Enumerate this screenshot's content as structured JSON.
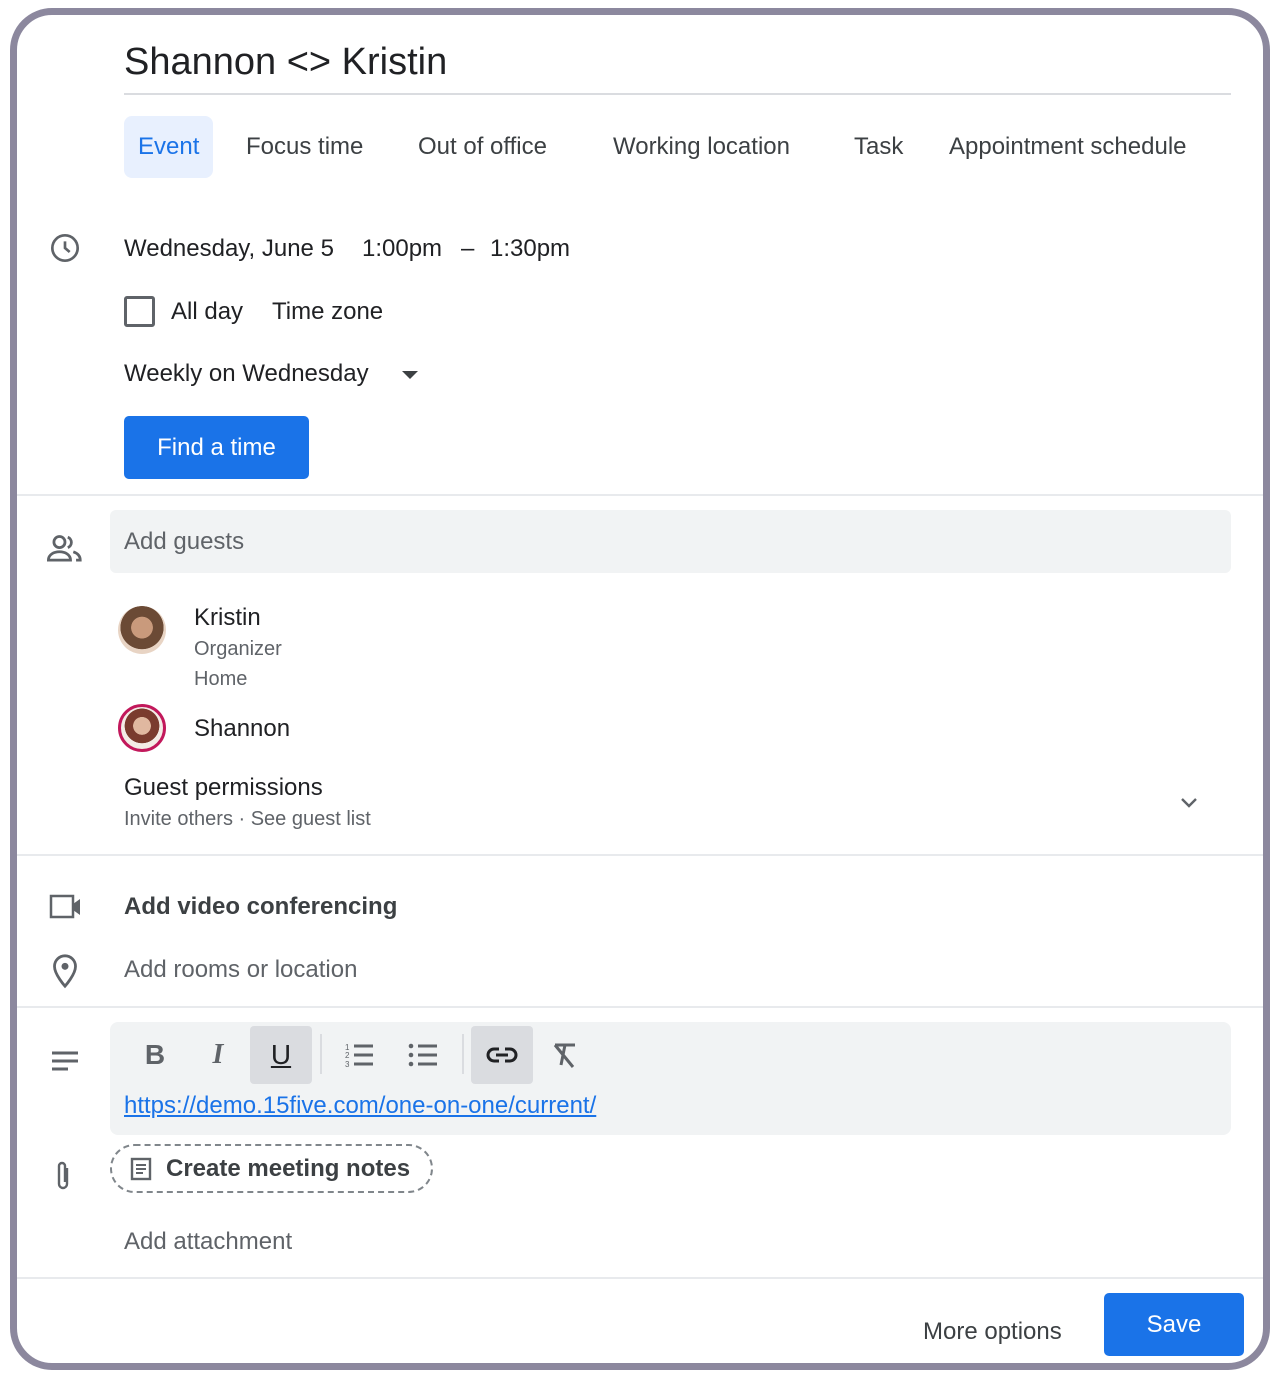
{
  "title": "Shannon <> Kristin",
  "tabs": [
    {
      "label": "Event",
      "active": true
    },
    {
      "label": "Focus time"
    },
    {
      "label": "Out of office"
    },
    {
      "label": "Working location"
    },
    {
      "label": "Task"
    },
    {
      "label": "Appointment schedule"
    }
  ],
  "datetime": {
    "date": "Wednesday, June 5",
    "start": "1:00pm",
    "dash": "–",
    "end": "1:30pm"
  },
  "all_day": {
    "label": "All day",
    "checked": false
  },
  "time_zone": "Time zone",
  "recurrence": "Weekly on Wednesday",
  "find_time": "Find a time",
  "guests": {
    "placeholder": "Add guests",
    "list": [
      {
        "name": "Kristin",
        "role": "Organizer",
        "location": "Home"
      },
      {
        "name": "Shannon"
      }
    ],
    "permissions_title": "Guest permissions",
    "permissions_sub": "Invite others · See guest list"
  },
  "video": "Add video conferencing",
  "location": "Add rooms or location",
  "editor": {
    "bold": "B",
    "italic": "I",
    "underline": "U",
    "link_text": "https://demo.15five.com/one-on-one/current/"
  },
  "meeting_notes": "Create meeting notes",
  "attachment": "Add attachment",
  "footer": {
    "more": "More options",
    "save": "Save"
  },
  "colors": {
    "accent": "#1a73e8",
    "frame": "#8c889e"
  }
}
